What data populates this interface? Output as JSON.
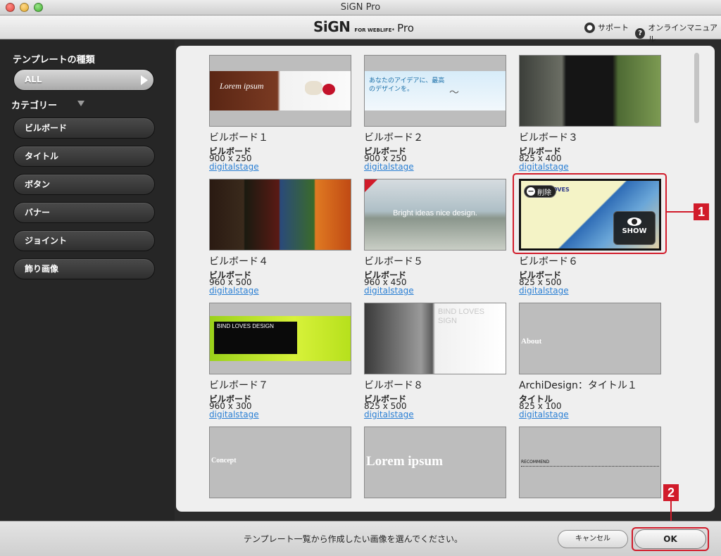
{
  "window": {
    "title": "SiGN Pro"
  },
  "header": {
    "logo_main": "SiGN",
    "logo_sub": "FOR WEBLIFE*",
    "logo_pro": "Pro",
    "support_label": "サポート",
    "manual_label": "オンラインマニュアル"
  },
  "sidebar": {
    "template_type_heading": "テンプレートの種類",
    "all_label": "ALL",
    "category_heading": "カテゴリー",
    "categories": [
      "ビルボード",
      "タイトル",
      "ボタン",
      "バナー",
      "ジョイント",
      "飾り画像"
    ]
  },
  "templates": [
    {
      "name": "ビルボード１",
      "category": "ビルボード",
      "size": "900 x 250",
      "author": "digitalstage",
      "thumb_text": "Lorem ipsum"
    },
    {
      "name": "ビルボード２",
      "category": "ビルボード",
      "size": "900 x 250",
      "author": "digitalstage",
      "thumb_text": "あなたのアイデアに、最高のデザインを。"
    },
    {
      "name": "ビルボード３",
      "category": "ビルボード",
      "size": "825 x 400",
      "author": "digitalstage",
      "thumb_text": ""
    },
    {
      "name": "ビルボード４",
      "category": "ビルボード",
      "size": "960 x 500",
      "author": "digitalstage",
      "thumb_text": ""
    },
    {
      "name": "ビルボード５",
      "category": "ビルボード",
      "size": "960 x 450",
      "author": "digitalstage",
      "thumb_text": "Bright ideas nice design."
    },
    {
      "name": "ビルボード６",
      "category": "ビルボード",
      "size": "825 x 500",
      "author": "digitalstage",
      "thumb_text": "LOVES",
      "delete_label": "削除",
      "show_label": "SHOW"
    },
    {
      "name": "ビルボード７",
      "category": "ビルボード",
      "size": "960 x 300",
      "author": "digitalstage",
      "thumb_text": "BIND LOVES DESIGN"
    },
    {
      "name": "ビルボード８",
      "category": "ビルボード",
      "size": "825 x 500",
      "author": "digitalstage",
      "thumb_text": "BIND LOVES SIGN"
    },
    {
      "name": "ArchiDesign：タイトル１",
      "category": "タイトル",
      "size": "825 x 100",
      "author": "digitalstage",
      "thumb_text": "About"
    },
    {
      "name": "",
      "category": "",
      "size": "",
      "author": "",
      "thumb_text": "Concept"
    },
    {
      "name": "",
      "category": "",
      "size": "",
      "author": "",
      "thumb_text": "Lorem ipsum"
    },
    {
      "name": "",
      "category": "",
      "size": "",
      "author": "",
      "thumb_text": "RECOMMEND"
    }
  ],
  "callouts": {
    "one": "1",
    "two": "2"
  },
  "footer": {
    "status": "テンプレート一覧から作成したい画像を選んでください。",
    "cancel_label": "キャンセル",
    "ok_label": "OK"
  },
  "colors": {
    "accent_red": "#d11b2a",
    "link_blue": "#2a7fd4",
    "sidebar_bg": "#262626",
    "panel_bg": "#efefef"
  }
}
